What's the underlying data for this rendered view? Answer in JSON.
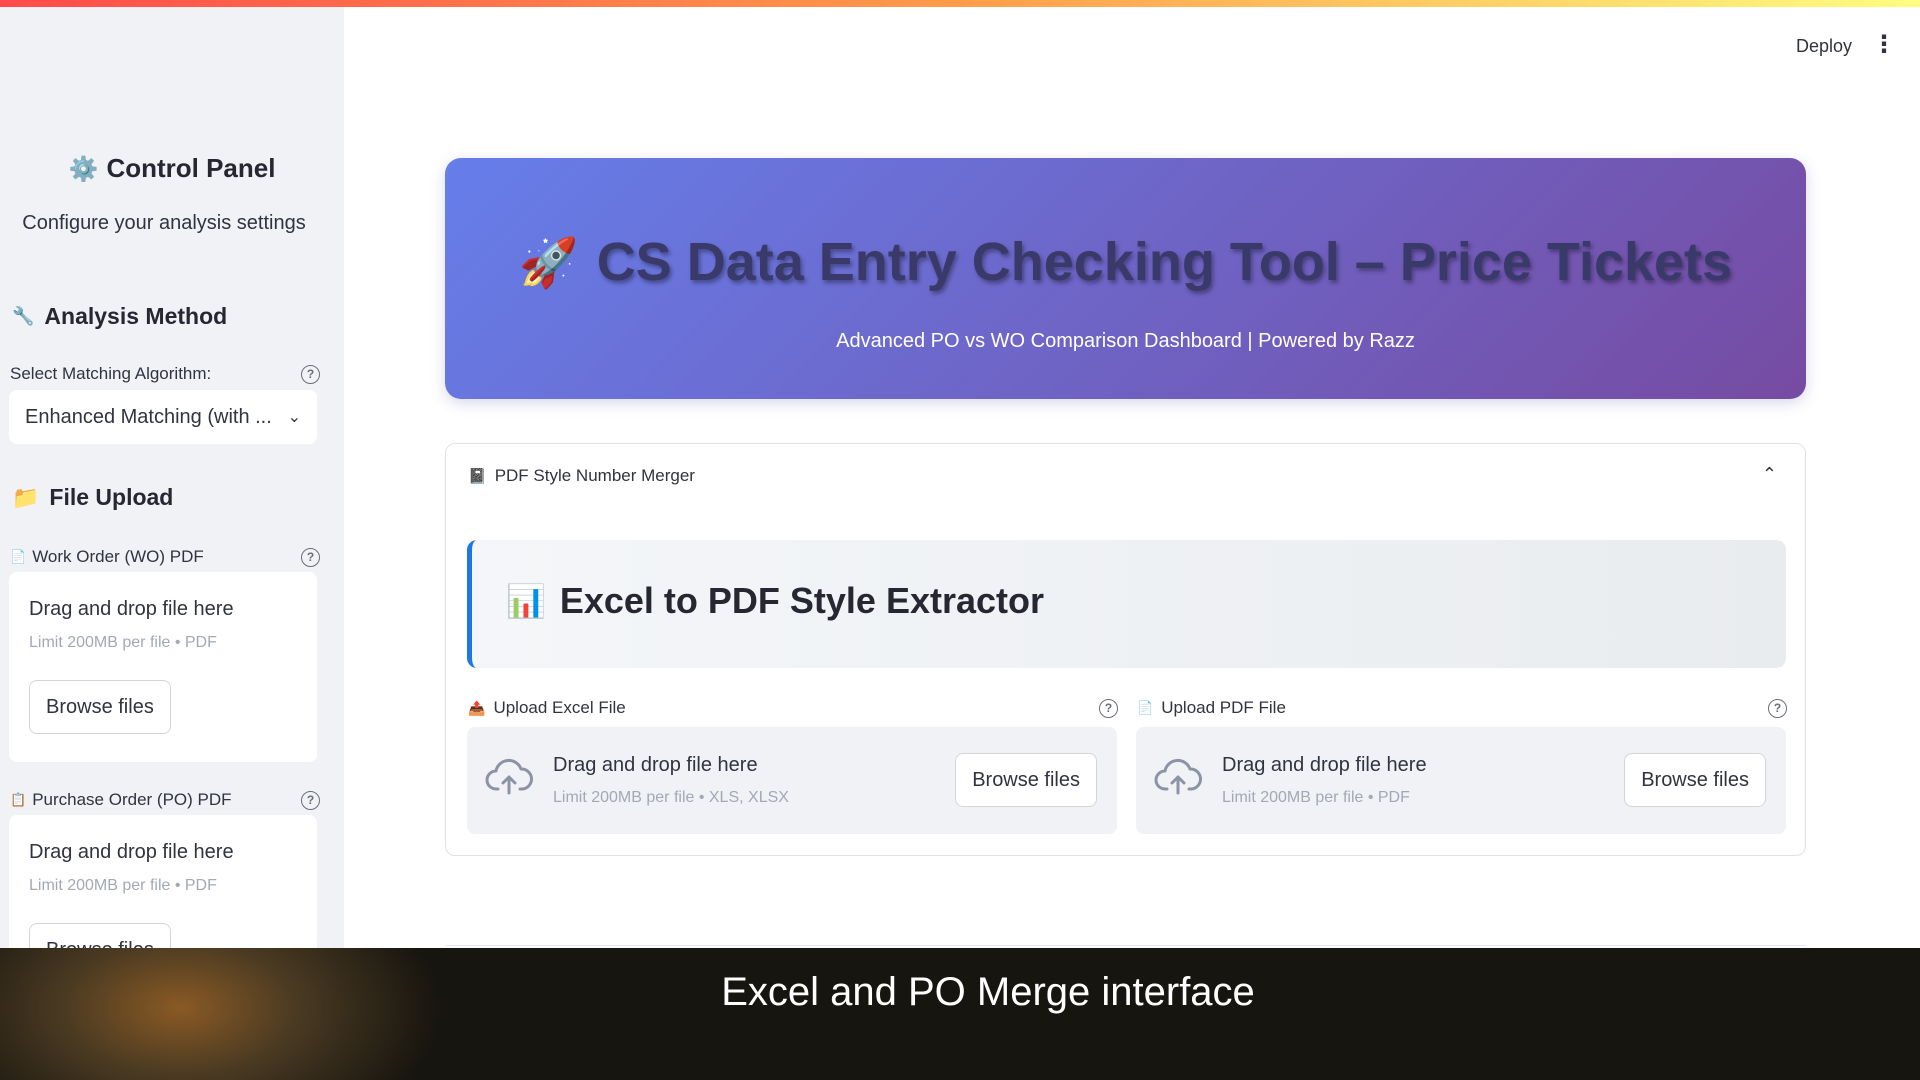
{
  "header": {
    "deploy_label": "Deploy",
    "menu_icon": "⋮"
  },
  "sidebar": {
    "title": "Control Panel",
    "title_icon": "⚙️",
    "subtitle": "Configure your analysis settings",
    "analysis": {
      "heading": "Analysis Method",
      "heading_icon": "🔧",
      "select_label": "Select Matching Algorithm:",
      "selected_value": "Enhanced Matching (with ..."
    },
    "upload": {
      "heading": "File Upload",
      "heading_icon": "📁",
      "wo": {
        "label": "Work Order (WO) PDF",
        "icon": "📄",
        "drop_title": "Drag and drop file here",
        "limit": "Limit 200MB per file • PDF",
        "button": "Browse files"
      },
      "po": {
        "label": "Purchase Order (PO) PDF",
        "icon": "📋",
        "drop_title": "Drag and drop file here",
        "limit": "Limit 200MB per file • PDF",
        "button": "Browse files"
      }
    }
  },
  "hero": {
    "icon": "🚀",
    "title": "CS Data Entry Checking Tool – Price Tickets",
    "subtitle": "Advanced PO vs WO Comparison Dashboard | Powered by Razz"
  },
  "expander": {
    "icon": "📓",
    "title": "PDF Style Number Merger",
    "section": {
      "icon": "📊",
      "title": "Excel to PDF Style Extractor"
    },
    "excel_upload": {
      "label": "Upload Excel File",
      "icon": "📤",
      "drop_title": "Drag and drop file here",
      "limit": "Limit 200MB per file • XLS, XLSX",
      "button": "Browse files"
    },
    "pdf_upload": {
      "label": "Upload PDF File",
      "icon": "📄",
      "drop_title": "Drag and drop file here",
      "limit": "Limit 200MB per file • PDF",
      "button": "Browse files"
    }
  },
  "caption": {
    "text": "Excel and PO Merge interface"
  },
  "colors": {
    "hero_start": "#667eea",
    "hero_end": "#764ba2",
    "accent_border": "#1f77e6",
    "sidebar_bg": "#f0f2f6"
  }
}
